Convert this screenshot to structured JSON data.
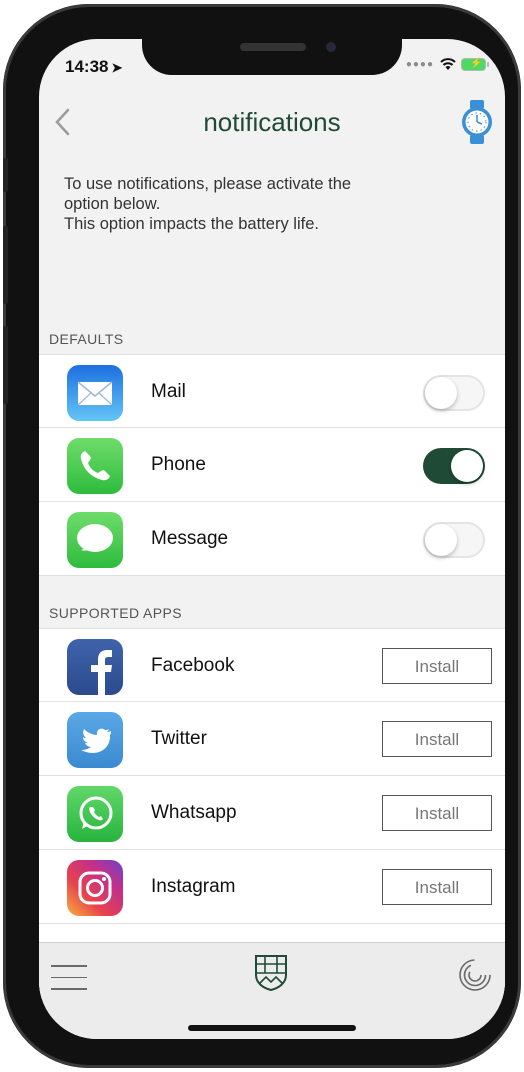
{
  "status_bar": {
    "time": "14:38"
  },
  "nav": {
    "title": "notifications",
    "back_icon": "chevron-left-icon",
    "watch_icon": "watch-icon"
  },
  "info": {
    "line1": "To use notifications, please activate the",
    "line2": "option below.",
    "line3": "This option impacts the battery life."
  },
  "defaults": {
    "header": "DEFAULTS",
    "items": [
      {
        "label": "Mail",
        "icon": "mail-icon",
        "enabled": false
      },
      {
        "label": "Phone",
        "icon": "phone-icon",
        "enabled": true
      },
      {
        "label": "Message",
        "icon": "message-icon",
        "enabled": false
      }
    ]
  },
  "supported_apps": {
    "header": "SUPPORTED APPS",
    "items": [
      {
        "label": "Facebook",
        "icon": "facebook-icon",
        "button": "Install"
      },
      {
        "label": "Twitter",
        "icon": "twitter-icon",
        "button": "Install"
      },
      {
        "label": "Whatsapp",
        "icon": "whatsapp-icon",
        "button": "Install"
      },
      {
        "label": "Instagram",
        "icon": "instagram-icon",
        "button": "Install"
      }
    ]
  },
  "colors": {
    "accent": "#1f4a36",
    "watch": "#3a8fd6"
  }
}
